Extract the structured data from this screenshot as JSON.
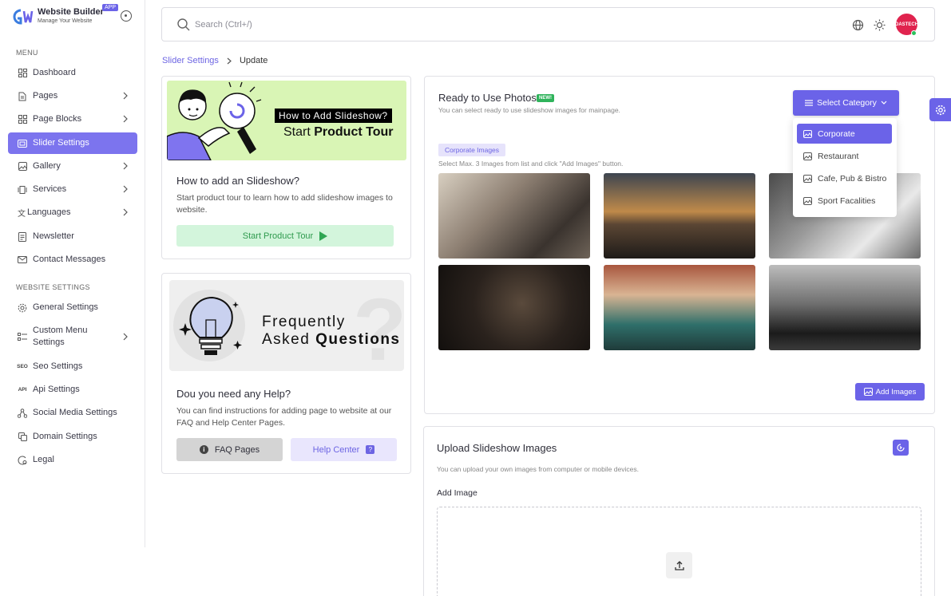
{
  "brand": {
    "title": "Website Builder",
    "subtitle": "Manage Your Website",
    "badge": "APP"
  },
  "sidebar": {
    "menu_label": "MENU",
    "settings_label": "WEBSITE SETTINGS",
    "items": [
      {
        "label": "Dashboard",
        "icon": "dashboard-icon"
      },
      {
        "label": "Pages",
        "icon": "page-icon"
      },
      {
        "label": "Page Blocks",
        "icon": "blocks-icon"
      },
      {
        "label": "Slider Settings",
        "icon": "slider-icon"
      },
      {
        "label": "Gallery",
        "icon": "gallery-icon"
      },
      {
        "label": "Services",
        "icon": "services-icon"
      },
      {
        "label": "Languages",
        "icon": "languages-icon"
      },
      {
        "label": "Newsletter",
        "icon": "newsletter-icon"
      },
      {
        "label": "Contact Messages",
        "icon": "mail-icon"
      }
    ],
    "settings_items": [
      {
        "label": "General Settings",
        "icon": "gear-icon"
      },
      {
        "label": "Custom Menu Settings",
        "icon": "menu-icon"
      },
      {
        "label": "Seo Settings",
        "icon": "seo-icon",
        "icon_text": "SEO"
      },
      {
        "label": "Api Settings",
        "icon": "api-icon",
        "icon_text": "API"
      },
      {
        "label": "Social Media Settings",
        "icon": "share-icon"
      },
      {
        "label": "Domain Settings",
        "icon": "domain-icon"
      },
      {
        "label": "Legal",
        "icon": "legal-icon"
      }
    ]
  },
  "search": {
    "placeholder": "Search (Ctrl+/)"
  },
  "avatar": {
    "text": "DASTECH"
  },
  "breadcrumb": {
    "parent": "Slider Settings",
    "current": "Update"
  },
  "tour_card": {
    "banner_box": "How to Add  Slideshow?",
    "banner_title_light": "Start ",
    "banner_title_bold": "Product Tour",
    "heading": "How to add an Slideshow?",
    "description": "Start product tour to learn how to add slideshow images to website.",
    "button": "Start Product Tour"
  },
  "help_card": {
    "banner_line1": "Frequently",
    "banner_line2_light": "Asked ",
    "banner_line2_bold": "Questions",
    "heading": "Dou you need any Help?",
    "description": "You can find instructions for adding page to website at our FAQ and Help Center Pages.",
    "faq_button": "FAQ Pages",
    "faq_icon": "i",
    "help_button": "Help Center",
    "help_icon": "?"
  },
  "photos_card": {
    "title": "Ready to Use Photos",
    "new_badge": "NEW!",
    "subtitle": "You can select ready to use slideshow images for mainpage.",
    "category_chip": "Corporate Images",
    "hint": "Select Max. 3 Images from list and click \"Add Images\" button.",
    "add_images_button": "Add Images",
    "select_category_button": "Select Category",
    "categories": [
      "Corporate",
      "Restaurant",
      "Cafe, Pub & Bistro",
      "Sport Facalities"
    ],
    "selected_category": "Corporate"
  },
  "upload_card": {
    "title": "Upload Slideshow Images",
    "subtitle": "You can upload your own images from computer or mobile devices.",
    "add_image_label": "Add Image"
  },
  "colors": {
    "accent": "#6b63e8",
    "accent_light": "#7c74ee",
    "success": "#2fa653"
  }
}
